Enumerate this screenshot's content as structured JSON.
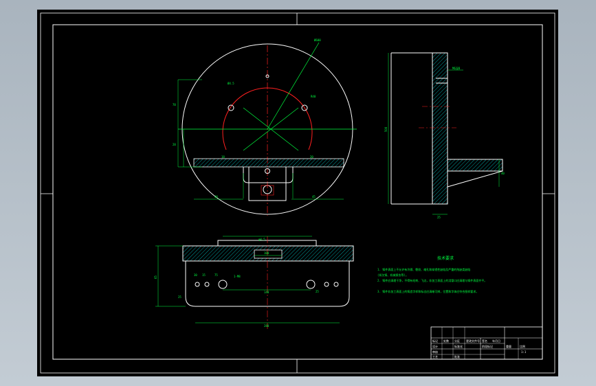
{
  "drawing": {
    "colors": {
      "background": "#000000",
      "frame": "#ffffff",
      "outline": "#ffffff",
      "centerline": "#ff2020",
      "dimension": "#00ff40",
      "annotation": "#00ff40",
      "hatch": "#00c8c8"
    },
    "top_view": {
      "dims": {
        "overall": "Ø600",
        "d1": "Ø4.5",
        "d2": "R40",
        "v1": "20",
        "v2": "70",
        "h1": "40",
        "h2": "45",
        "small1": "18",
        "small2": "20"
      }
    },
    "side_view": {
      "dims": {
        "height": "500",
        "flange": "40",
        "base": "25",
        "note": "M6深8"
      }
    },
    "front_view": {
      "dims": {
        "top": "φ4.5",
        "hole": "1-M8",
        "width": "280",
        "inner": "140",
        "h1": "65",
        "h2": "25",
        "h3": "30",
        "h4": "15",
        "d1": "75",
        "d2": "25",
        "slot": "100"
      }
    },
    "notes": {
      "title": "技术要求",
      "lines": [
        "1. 铸件表面上不允许有冷隔、裂纹、缩孔和穿透性缺陷及严重的残缺类缺陷",
        "(如欠铸、机械损伤等)。",
        "2. 铸件应清理干净，不得有毛刺、飞边，非加工表面上的浇冒口应清理与铸件表面齐平。",
        "3. 铸件非加工表面上的铸造字样和标志应清晰可辨，位置和字体应符合图样要求。"
      ]
    },
    "title_block": {
      "cells": [
        "标记",
        "处数",
        "分区",
        "更改文件号",
        "签名",
        "年月日",
        "设计",
        "标准化",
        "审核",
        "工艺",
        "批准",
        "阶段标记",
        "重量",
        "比例",
        "1:1"
      ]
    }
  }
}
